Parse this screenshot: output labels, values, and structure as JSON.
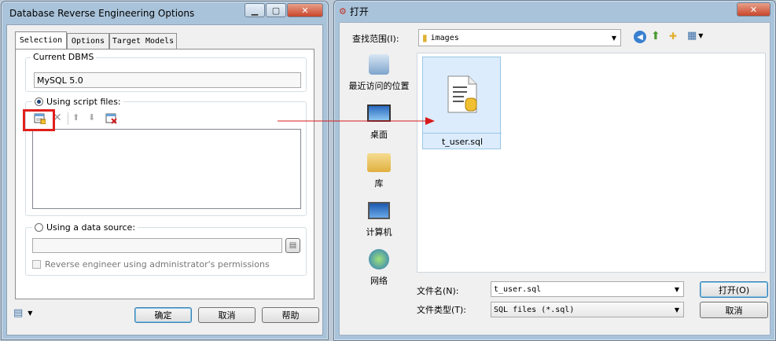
{
  "left_dialog": {
    "title": "Database Reverse Engineering Options",
    "tabs": [
      {
        "label": "Selection"
      },
      {
        "label": "Options"
      },
      {
        "label": "Target Models"
      }
    ],
    "current_dbms": {
      "label": "Current DBMS",
      "value": "MySQL 5.0"
    },
    "script_files": {
      "label": "Using script files:",
      "selected": true
    },
    "data_source": {
      "label": "Using a data source:",
      "value": ""
    },
    "admin_permissions": {
      "label": "Reverse engineer using administrator's permissions",
      "checked": false
    },
    "buttons": {
      "ok": "确定",
      "cancel": "取消",
      "help": "帮助"
    }
  },
  "open_dialog": {
    "title": "打开",
    "look_in": {
      "label": "查找范围(I):",
      "value": "images"
    },
    "places": [
      {
        "label": "最近访问的位置"
      },
      {
        "label": "桌面"
      },
      {
        "label": "库"
      },
      {
        "label": "计算机"
      },
      {
        "label": "网络"
      }
    ],
    "files": [
      {
        "name": "t_user.sql",
        "selected": true
      }
    ],
    "filename": {
      "label": "文件名(N):",
      "value": "t_user.sql"
    },
    "filetype": {
      "label": "文件类型(T):",
      "value": "SQL files (*.sql)"
    },
    "buttons": {
      "open": "打开(O)",
      "cancel": "取消"
    }
  },
  "colors": {
    "highlight": "#e0201b",
    "arrow": "#d81a1a",
    "title_bg": "#a9c3da"
  }
}
